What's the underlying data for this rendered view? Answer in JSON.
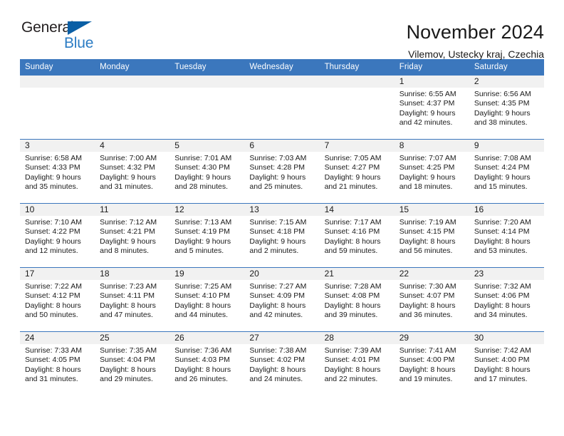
{
  "brand": {
    "logo_text_primary": "General",
    "logo_text_secondary": "Blue",
    "logo_triangle_color": "#0b5fa5",
    "logo_blue_color": "#2b7cc4"
  },
  "header": {
    "month_title": "November 2024",
    "location": "Vilemov, Ustecky kraj, Czechia"
  },
  "theme": {
    "header_blue": "#3b77bd",
    "daynum_band_gray": "#f1f1f1",
    "text_color": "#1a1a1a"
  },
  "calendar": {
    "weekday_headers": [
      "Sunday",
      "Monday",
      "Tuesday",
      "Wednesday",
      "Thursday",
      "Friday",
      "Saturday"
    ],
    "weeks": [
      [
        {
          "day": "",
          "blank": true,
          "sunrise": "",
          "sunset": "",
          "daylight_line1": "",
          "daylight_line2": ""
        },
        {
          "day": "",
          "blank": true,
          "sunrise": "",
          "sunset": "",
          "daylight_line1": "",
          "daylight_line2": ""
        },
        {
          "day": "",
          "blank": true,
          "sunrise": "",
          "sunset": "",
          "daylight_line1": "",
          "daylight_line2": ""
        },
        {
          "day": "",
          "blank": true,
          "sunrise": "",
          "sunset": "",
          "daylight_line1": "",
          "daylight_line2": ""
        },
        {
          "day": "",
          "blank": true,
          "sunrise": "",
          "sunset": "",
          "daylight_line1": "",
          "daylight_line2": ""
        },
        {
          "day": "1",
          "blank": false,
          "sunrise": "Sunrise: 6:55 AM",
          "sunset": "Sunset: 4:37 PM",
          "daylight_line1": "Daylight: 9 hours",
          "daylight_line2": "and 42 minutes."
        },
        {
          "day": "2",
          "blank": false,
          "sunrise": "Sunrise: 6:56 AM",
          "sunset": "Sunset: 4:35 PM",
          "daylight_line1": "Daylight: 9 hours",
          "daylight_line2": "and 38 minutes."
        }
      ],
      [
        {
          "day": "3",
          "blank": false,
          "sunrise": "Sunrise: 6:58 AM",
          "sunset": "Sunset: 4:33 PM",
          "daylight_line1": "Daylight: 9 hours",
          "daylight_line2": "and 35 minutes."
        },
        {
          "day": "4",
          "blank": false,
          "sunrise": "Sunrise: 7:00 AM",
          "sunset": "Sunset: 4:32 PM",
          "daylight_line1": "Daylight: 9 hours",
          "daylight_line2": "and 31 minutes."
        },
        {
          "day": "5",
          "blank": false,
          "sunrise": "Sunrise: 7:01 AM",
          "sunset": "Sunset: 4:30 PM",
          "daylight_line1": "Daylight: 9 hours",
          "daylight_line2": "and 28 minutes."
        },
        {
          "day": "6",
          "blank": false,
          "sunrise": "Sunrise: 7:03 AM",
          "sunset": "Sunset: 4:28 PM",
          "daylight_line1": "Daylight: 9 hours",
          "daylight_line2": "and 25 minutes."
        },
        {
          "day": "7",
          "blank": false,
          "sunrise": "Sunrise: 7:05 AM",
          "sunset": "Sunset: 4:27 PM",
          "daylight_line1": "Daylight: 9 hours",
          "daylight_line2": "and 21 minutes."
        },
        {
          "day": "8",
          "blank": false,
          "sunrise": "Sunrise: 7:07 AM",
          "sunset": "Sunset: 4:25 PM",
          "daylight_line1": "Daylight: 9 hours",
          "daylight_line2": "and 18 minutes."
        },
        {
          "day": "9",
          "blank": false,
          "sunrise": "Sunrise: 7:08 AM",
          "sunset": "Sunset: 4:24 PM",
          "daylight_line1": "Daylight: 9 hours",
          "daylight_line2": "and 15 minutes."
        }
      ],
      [
        {
          "day": "10",
          "blank": false,
          "sunrise": "Sunrise: 7:10 AM",
          "sunset": "Sunset: 4:22 PM",
          "daylight_line1": "Daylight: 9 hours",
          "daylight_line2": "and 12 minutes."
        },
        {
          "day": "11",
          "blank": false,
          "sunrise": "Sunrise: 7:12 AM",
          "sunset": "Sunset: 4:21 PM",
          "daylight_line1": "Daylight: 9 hours",
          "daylight_line2": "and 8 minutes."
        },
        {
          "day": "12",
          "blank": false,
          "sunrise": "Sunrise: 7:13 AM",
          "sunset": "Sunset: 4:19 PM",
          "daylight_line1": "Daylight: 9 hours",
          "daylight_line2": "and 5 minutes."
        },
        {
          "day": "13",
          "blank": false,
          "sunrise": "Sunrise: 7:15 AM",
          "sunset": "Sunset: 4:18 PM",
          "daylight_line1": "Daylight: 9 hours",
          "daylight_line2": "and 2 minutes."
        },
        {
          "day": "14",
          "blank": false,
          "sunrise": "Sunrise: 7:17 AM",
          "sunset": "Sunset: 4:16 PM",
          "daylight_line1": "Daylight: 8 hours",
          "daylight_line2": "and 59 minutes."
        },
        {
          "day": "15",
          "blank": false,
          "sunrise": "Sunrise: 7:19 AM",
          "sunset": "Sunset: 4:15 PM",
          "daylight_line1": "Daylight: 8 hours",
          "daylight_line2": "and 56 minutes."
        },
        {
          "day": "16",
          "blank": false,
          "sunrise": "Sunrise: 7:20 AM",
          "sunset": "Sunset: 4:14 PM",
          "daylight_line1": "Daylight: 8 hours",
          "daylight_line2": "and 53 minutes."
        }
      ],
      [
        {
          "day": "17",
          "blank": false,
          "sunrise": "Sunrise: 7:22 AM",
          "sunset": "Sunset: 4:12 PM",
          "daylight_line1": "Daylight: 8 hours",
          "daylight_line2": "and 50 minutes."
        },
        {
          "day": "18",
          "blank": false,
          "sunrise": "Sunrise: 7:23 AM",
          "sunset": "Sunset: 4:11 PM",
          "daylight_line1": "Daylight: 8 hours",
          "daylight_line2": "and 47 minutes."
        },
        {
          "day": "19",
          "blank": false,
          "sunrise": "Sunrise: 7:25 AM",
          "sunset": "Sunset: 4:10 PM",
          "daylight_line1": "Daylight: 8 hours",
          "daylight_line2": "and 44 minutes."
        },
        {
          "day": "20",
          "blank": false,
          "sunrise": "Sunrise: 7:27 AM",
          "sunset": "Sunset: 4:09 PM",
          "daylight_line1": "Daylight: 8 hours",
          "daylight_line2": "and 42 minutes."
        },
        {
          "day": "21",
          "blank": false,
          "sunrise": "Sunrise: 7:28 AM",
          "sunset": "Sunset: 4:08 PM",
          "daylight_line1": "Daylight: 8 hours",
          "daylight_line2": "and 39 minutes."
        },
        {
          "day": "22",
          "blank": false,
          "sunrise": "Sunrise: 7:30 AM",
          "sunset": "Sunset: 4:07 PM",
          "daylight_line1": "Daylight: 8 hours",
          "daylight_line2": "and 36 minutes."
        },
        {
          "day": "23",
          "blank": false,
          "sunrise": "Sunrise: 7:32 AM",
          "sunset": "Sunset: 4:06 PM",
          "daylight_line1": "Daylight: 8 hours",
          "daylight_line2": "and 34 minutes."
        }
      ],
      [
        {
          "day": "24",
          "blank": false,
          "sunrise": "Sunrise: 7:33 AM",
          "sunset": "Sunset: 4:05 PM",
          "daylight_line1": "Daylight: 8 hours",
          "daylight_line2": "and 31 minutes."
        },
        {
          "day": "25",
          "blank": false,
          "sunrise": "Sunrise: 7:35 AM",
          "sunset": "Sunset: 4:04 PM",
          "daylight_line1": "Daylight: 8 hours",
          "daylight_line2": "and 29 minutes."
        },
        {
          "day": "26",
          "blank": false,
          "sunrise": "Sunrise: 7:36 AM",
          "sunset": "Sunset: 4:03 PM",
          "daylight_line1": "Daylight: 8 hours",
          "daylight_line2": "and 26 minutes."
        },
        {
          "day": "27",
          "blank": false,
          "sunrise": "Sunrise: 7:38 AM",
          "sunset": "Sunset: 4:02 PM",
          "daylight_line1": "Daylight: 8 hours",
          "daylight_line2": "and 24 minutes."
        },
        {
          "day": "28",
          "blank": false,
          "sunrise": "Sunrise: 7:39 AM",
          "sunset": "Sunset: 4:01 PM",
          "daylight_line1": "Daylight: 8 hours",
          "daylight_line2": "and 22 minutes."
        },
        {
          "day": "29",
          "blank": false,
          "sunrise": "Sunrise: 7:41 AM",
          "sunset": "Sunset: 4:00 PM",
          "daylight_line1": "Daylight: 8 hours",
          "daylight_line2": "and 19 minutes."
        },
        {
          "day": "30",
          "blank": false,
          "sunrise": "Sunrise: 7:42 AM",
          "sunset": "Sunset: 4:00 PM",
          "daylight_line1": "Daylight: 8 hours",
          "daylight_line2": "and 17 minutes."
        }
      ]
    ]
  }
}
